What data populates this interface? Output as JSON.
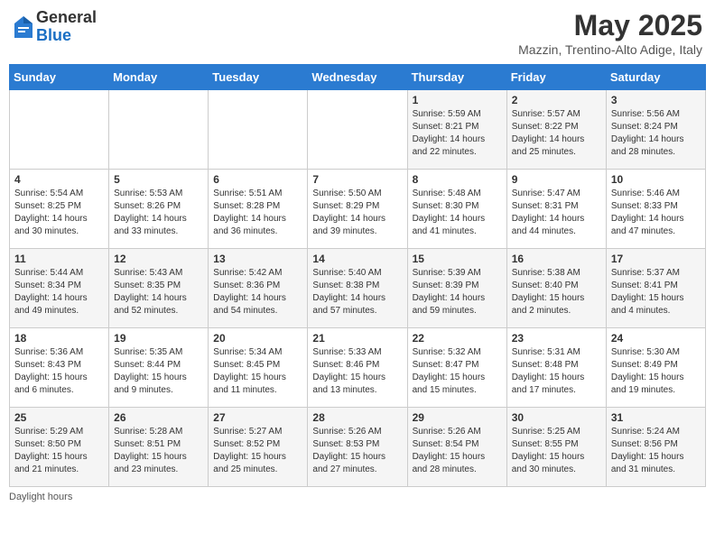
{
  "header": {
    "logo_general": "General",
    "logo_blue": "Blue",
    "month_year": "May 2025",
    "location": "Mazzin, Trentino-Alto Adige, Italy"
  },
  "days_of_week": [
    "Sunday",
    "Monday",
    "Tuesday",
    "Wednesday",
    "Thursday",
    "Friday",
    "Saturday"
  ],
  "weeks": [
    [
      {
        "day": "",
        "info": ""
      },
      {
        "day": "",
        "info": ""
      },
      {
        "day": "",
        "info": ""
      },
      {
        "day": "",
        "info": ""
      },
      {
        "day": "1",
        "info": "Sunrise: 5:59 AM\nSunset: 8:21 PM\nDaylight: 14 hours\nand 22 minutes."
      },
      {
        "day": "2",
        "info": "Sunrise: 5:57 AM\nSunset: 8:22 PM\nDaylight: 14 hours\nand 25 minutes."
      },
      {
        "day": "3",
        "info": "Sunrise: 5:56 AM\nSunset: 8:24 PM\nDaylight: 14 hours\nand 28 minutes."
      }
    ],
    [
      {
        "day": "4",
        "info": "Sunrise: 5:54 AM\nSunset: 8:25 PM\nDaylight: 14 hours\nand 30 minutes."
      },
      {
        "day": "5",
        "info": "Sunrise: 5:53 AM\nSunset: 8:26 PM\nDaylight: 14 hours\nand 33 minutes."
      },
      {
        "day": "6",
        "info": "Sunrise: 5:51 AM\nSunset: 8:28 PM\nDaylight: 14 hours\nand 36 minutes."
      },
      {
        "day": "7",
        "info": "Sunrise: 5:50 AM\nSunset: 8:29 PM\nDaylight: 14 hours\nand 39 minutes."
      },
      {
        "day": "8",
        "info": "Sunrise: 5:48 AM\nSunset: 8:30 PM\nDaylight: 14 hours\nand 41 minutes."
      },
      {
        "day": "9",
        "info": "Sunrise: 5:47 AM\nSunset: 8:31 PM\nDaylight: 14 hours\nand 44 minutes."
      },
      {
        "day": "10",
        "info": "Sunrise: 5:46 AM\nSunset: 8:33 PM\nDaylight: 14 hours\nand 47 minutes."
      }
    ],
    [
      {
        "day": "11",
        "info": "Sunrise: 5:44 AM\nSunset: 8:34 PM\nDaylight: 14 hours\nand 49 minutes."
      },
      {
        "day": "12",
        "info": "Sunrise: 5:43 AM\nSunset: 8:35 PM\nDaylight: 14 hours\nand 52 minutes."
      },
      {
        "day": "13",
        "info": "Sunrise: 5:42 AM\nSunset: 8:36 PM\nDaylight: 14 hours\nand 54 minutes."
      },
      {
        "day": "14",
        "info": "Sunrise: 5:40 AM\nSunset: 8:38 PM\nDaylight: 14 hours\nand 57 minutes."
      },
      {
        "day": "15",
        "info": "Sunrise: 5:39 AM\nSunset: 8:39 PM\nDaylight: 14 hours\nand 59 minutes."
      },
      {
        "day": "16",
        "info": "Sunrise: 5:38 AM\nSunset: 8:40 PM\nDaylight: 15 hours\nand 2 minutes."
      },
      {
        "day": "17",
        "info": "Sunrise: 5:37 AM\nSunset: 8:41 PM\nDaylight: 15 hours\nand 4 minutes."
      }
    ],
    [
      {
        "day": "18",
        "info": "Sunrise: 5:36 AM\nSunset: 8:43 PM\nDaylight: 15 hours\nand 6 minutes."
      },
      {
        "day": "19",
        "info": "Sunrise: 5:35 AM\nSunset: 8:44 PM\nDaylight: 15 hours\nand 9 minutes."
      },
      {
        "day": "20",
        "info": "Sunrise: 5:34 AM\nSunset: 8:45 PM\nDaylight: 15 hours\nand 11 minutes."
      },
      {
        "day": "21",
        "info": "Sunrise: 5:33 AM\nSunset: 8:46 PM\nDaylight: 15 hours\nand 13 minutes."
      },
      {
        "day": "22",
        "info": "Sunrise: 5:32 AM\nSunset: 8:47 PM\nDaylight: 15 hours\nand 15 minutes."
      },
      {
        "day": "23",
        "info": "Sunrise: 5:31 AM\nSunset: 8:48 PM\nDaylight: 15 hours\nand 17 minutes."
      },
      {
        "day": "24",
        "info": "Sunrise: 5:30 AM\nSunset: 8:49 PM\nDaylight: 15 hours\nand 19 minutes."
      }
    ],
    [
      {
        "day": "25",
        "info": "Sunrise: 5:29 AM\nSunset: 8:50 PM\nDaylight: 15 hours\nand 21 minutes."
      },
      {
        "day": "26",
        "info": "Sunrise: 5:28 AM\nSunset: 8:51 PM\nDaylight: 15 hours\nand 23 minutes."
      },
      {
        "day": "27",
        "info": "Sunrise: 5:27 AM\nSunset: 8:52 PM\nDaylight: 15 hours\nand 25 minutes."
      },
      {
        "day": "28",
        "info": "Sunrise: 5:26 AM\nSunset: 8:53 PM\nDaylight: 15 hours\nand 27 minutes."
      },
      {
        "day": "29",
        "info": "Sunrise: 5:26 AM\nSunset: 8:54 PM\nDaylight: 15 hours\nand 28 minutes."
      },
      {
        "day": "30",
        "info": "Sunrise: 5:25 AM\nSunset: 8:55 PM\nDaylight: 15 hours\nand 30 minutes."
      },
      {
        "day": "31",
        "info": "Sunrise: 5:24 AM\nSunset: 8:56 PM\nDaylight: 15 hours\nand 31 minutes."
      }
    ]
  ],
  "footer": {
    "daylight_hours": "Daylight hours"
  }
}
